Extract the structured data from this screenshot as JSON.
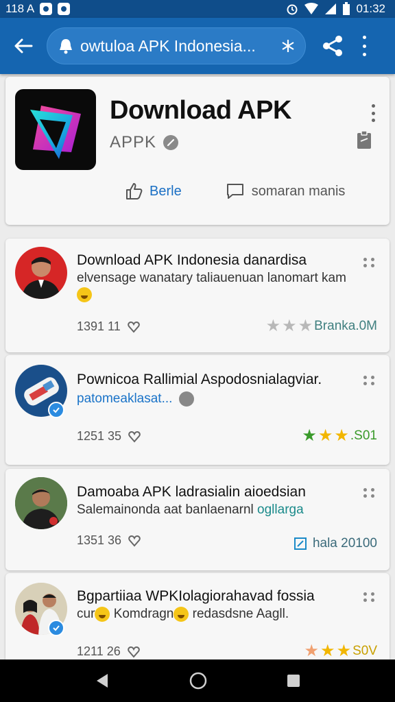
{
  "status_bar": {
    "left_text": "118 A",
    "time": "01:32"
  },
  "app_bar": {
    "search_text": "owtuloa APK Indonesia...",
    "back_icon": "back-arrow-icon",
    "share_icon": "share-icon"
  },
  "app": {
    "name": "Download APK",
    "developer": "APPK",
    "like_label": "Berle",
    "comment_label": "somaran manis"
  },
  "posts": [
    {
      "title": "Download APK Indonesia danardisa",
      "subtitle": "elvensage wanatary taliauenuan lanomart kam",
      "meta": "1391 11",
      "rating_text": "Branka.0M",
      "rating_color": "#9e9e9e",
      "star_color": "#b0b0b0"
    },
    {
      "title": "Pownicoa Rallimial Aspodosnialagviar.",
      "subtitle": "patomeaklasat...",
      "meta": "1251 35",
      "rating_text": ".S01",
      "star_colors": [
        "#3a9a2a",
        "#f2b600",
        "#f2b600"
      ]
    },
    {
      "title": "Damoaba APK ladrasialin aioedsian",
      "subtitle_main": "Salemainonda aat banlaenarnl",
      "subtitle_accent": "ogllarga",
      "meta": "1351 36",
      "rating_text": "hala 20100"
    },
    {
      "title": "Bgpartiiaa WPKIolagiorahavad fossia",
      "subtitle_a": "cur",
      "subtitle_b": "Komdragn",
      "subtitle_c": "redasdsne Aagll.",
      "meta": "1211 26",
      "rating_text": "S0V",
      "star_colors": [
        "#f0a070",
        "#f2b600",
        "#f2b600"
      ]
    }
  ],
  "colors": {
    "app_bar": "#1565b0",
    "status_bar": "#0f4d8a",
    "link": "#1a6fc4"
  }
}
